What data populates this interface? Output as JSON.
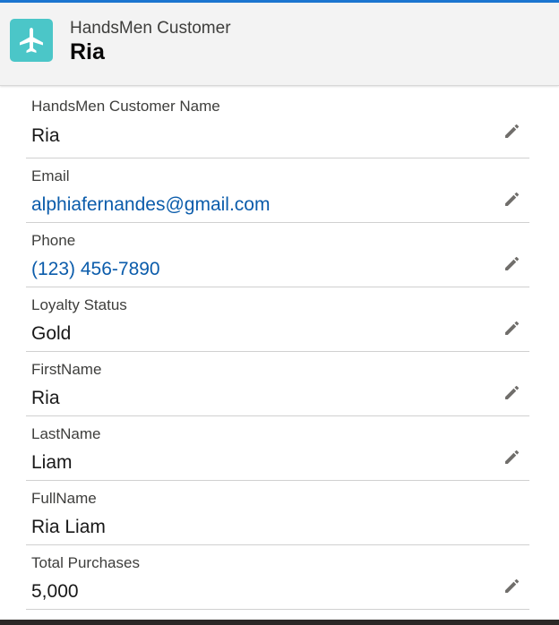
{
  "colors": {
    "accent": "#1b75d0",
    "icon_bg": "#4bc6c8",
    "link": "#0b5cab"
  },
  "header": {
    "icon": "airplane-icon",
    "object_type": "HandsMen Customer",
    "record_name": "Ria"
  },
  "fields": [
    {
      "label": "HandsMen Customer Name",
      "value": "Ria",
      "editable": true,
      "link": false
    },
    {
      "label": "Email",
      "value": "alphiafernandes@gmail.com",
      "editable": true,
      "link": true
    },
    {
      "label": "Phone",
      "value": "(123) 456-7890",
      "editable": true,
      "link": true
    },
    {
      "label": "Loyalty Status",
      "value": "Gold",
      "editable": true,
      "link": false
    },
    {
      "label": "FirstName",
      "value": "Ria",
      "editable": true,
      "link": false
    },
    {
      "label": "LastName",
      "value": "Liam",
      "editable": true,
      "link": false
    },
    {
      "label": "FullName",
      "value": "Ria Liam",
      "editable": false,
      "link": false
    },
    {
      "label": "Total Purchases",
      "value": "5,000",
      "editable": true,
      "link": false
    }
  ],
  "edit_icon": "pencil-icon"
}
